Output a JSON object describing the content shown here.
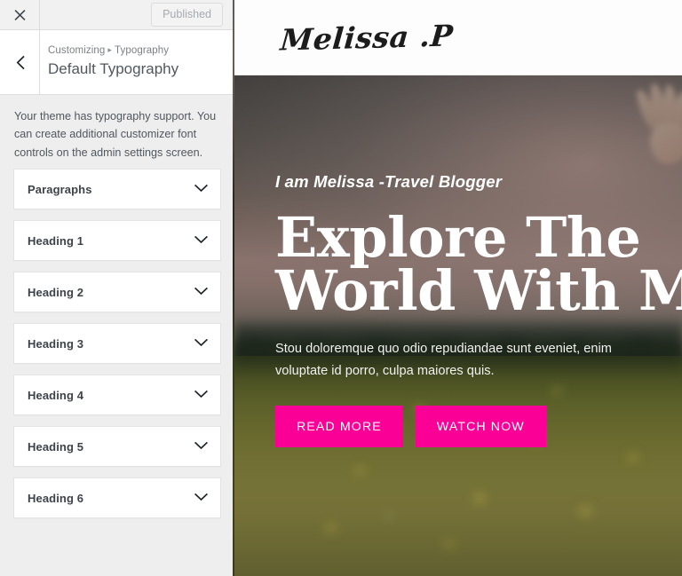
{
  "customizer": {
    "topbar": {
      "close_icon": "close-icon",
      "publish_label": "Published"
    },
    "header": {
      "back_icon": "chevron-left-icon",
      "breadcrumb_root": "Customizing",
      "breadcrumb_separator": "▸",
      "breadcrumb_current": "Typography",
      "panel_title": "Default Typography"
    },
    "description": "Your theme has typography support. You can create additional customizer font controls on the admin settings screen.",
    "accordion_icon": "chevron-down-icon",
    "accordion_items": [
      {
        "label": "Paragraphs"
      },
      {
        "label": "Heading 1"
      },
      {
        "label": "Heading 2"
      },
      {
        "label": "Heading 3"
      },
      {
        "label": "Heading 4"
      },
      {
        "label": "Heading 5"
      },
      {
        "label": "Heading 6"
      }
    ]
  },
  "preview": {
    "site_logo": "Melissa .P",
    "hero": {
      "eyebrow": "I am Melissa -Travel Blogger",
      "title_line1": "Explore The",
      "title_line2": "World With Me",
      "description": "Stou doloremque quo odio repudiandae sunt eveniet, enim voluptate id porro, culpa maiores quis.",
      "primary_button": "READ MORE",
      "secondary_button": "WATCH NOW"
    }
  },
  "colors": {
    "accent_pink": "#FB0096",
    "sidebar_bg": "#EEEEEE",
    "panel_white": "#FFFFFF",
    "title_text": "#50575E",
    "label_text": "#3C434A",
    "muted_text": "#7C8085",
    "published_text": "#A7AAAD",
    "hero_text": "#FFFFFF"
  }
}
